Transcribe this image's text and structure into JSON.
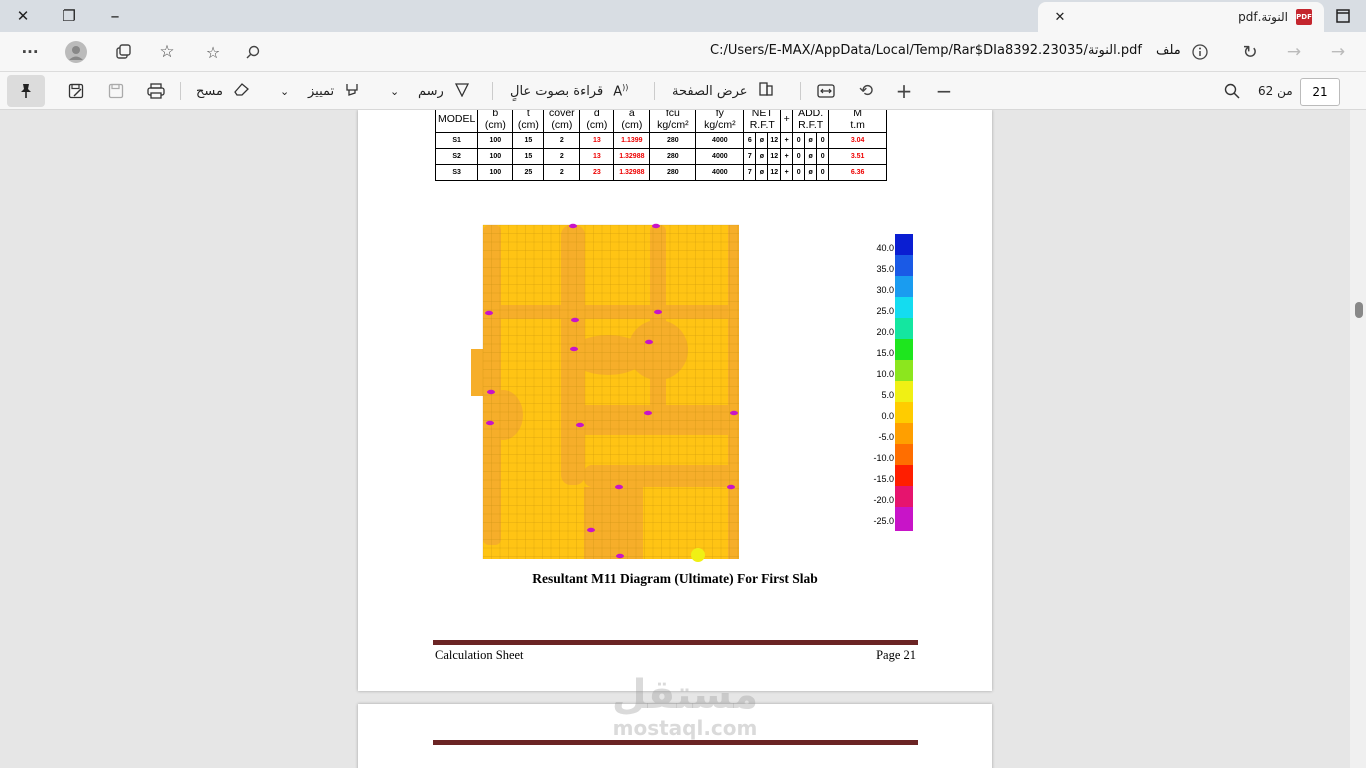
{
  "window": {
    "tab_title": "النوتة.pdf",
    "tab_icon": "pdf-icon",
    "tab_pdf_text": "PDF",
    "close_glyph": "✕",
    "restore_glyph": "❐",
    "newtab_glyph": "+",
    "tabclose_glyph": "✕"
  },
  "address_bar": {
    "label": "ملف",
    "url": "C:/Users/E-MAX/AppData/Local/Temp/Rar$DIa8392.23035/النوتة.pdf",
    "more_glyph": "···"
  },
  "pdf_toolbar": {
    "erase": "مسح",
    "highlight": "تمييز",
    "draw": "رسم",
    "read_aloud": "قراءة بصوت عالٍ",
    "page_view": "عرض الصفحة",
    "page_of": "من 62",
    "current_page": "21"
  },
  "table": {
    "header": [
      "MODEL\n",
      "b\n(cm)",
      "t\n(cm)",
      "cover\n(cm)",
      "d\n(cm)",
      "a\n(cm)",
      "fcu\nkg/cm²",
      "fy\nkg/cm²",
      "NET\nR.F.T",
      "+",
      "ADD.\nR.F.T",
      "M\nt.m"
    ],
    "rows": [
      {
        "model": "S1",
        "b": "100",
        "t": "15",
        "cover": "2",
        "d": "13",
        "a": "1.1399",
        "fcu": "280",
        "fy": "4000",
        "n": "6",
        "phi": "ø",
        "dia": "12",
        "plus": "+",
        "an": "0",
        "aphi": "ø",
        "adia": "0",
        "m": "3.04"
      },
      {
        "model": "S2",
        "b": "100",
        "t": "15",
        "cover": "2",
        "d": "13",
        "a": "1.32988",
        "fcu": "280",
        "fy": "4000",
        "n": "7",
        "phi": "ø",
        "dia": "12",
        "plus": "+",
        "an": "0",
        "aphi": "ø",
        "adia": "0",
        "m": "3.51"
      },
      {
        "model": "S3",
        "b": "100",
        "t": "25",
        "cover": "2",
        "d": "23",
        "a": "1.32988",
        "fcu": "280",
        "fy": "4000",
        "n": "7",
        "phi": "ø",
        "dia": "12",
        "plus": "+",
        "an": "0",
        "aphi": "ø",
        "adia": "0",
        "m": "6.36"
      }
    ]
  },
  "legend": {
    "labels": [
      "40.0",
      "35.0",
      "30.0",
      "25.0",
      "20.0",
      "15.0",
      "10.0",
      "5.0",
      "0.0",
      "-5.0",
      "-10.0",
      "-15.0",
      "-20.0",
      "-25.0"
    ],
    "colors": [
      "#0a1ed2",
      "#1a5ae6",
      "#1a9cf0",
      "#14dcf0",
      "#14e6a0",
      "#1ee61e",
      "#8ce61e",
      "#f0f014",
      "#ffcc00",
      "#ff9f00",
      "#ff6e00",
      "#ff1e00",
      "#e6146e",
      "#c814c8"
    ]
  },
  "caption": "Resultant M11 Diagram (Ultimate) For First Slab",
  "footer": {
    "left": "Calculation Sheet",
    "right": "Page 21"
  },
  "watermark": {
    "arabic": "مستقل",
    "latin": "mostaql.com"
  }
}
